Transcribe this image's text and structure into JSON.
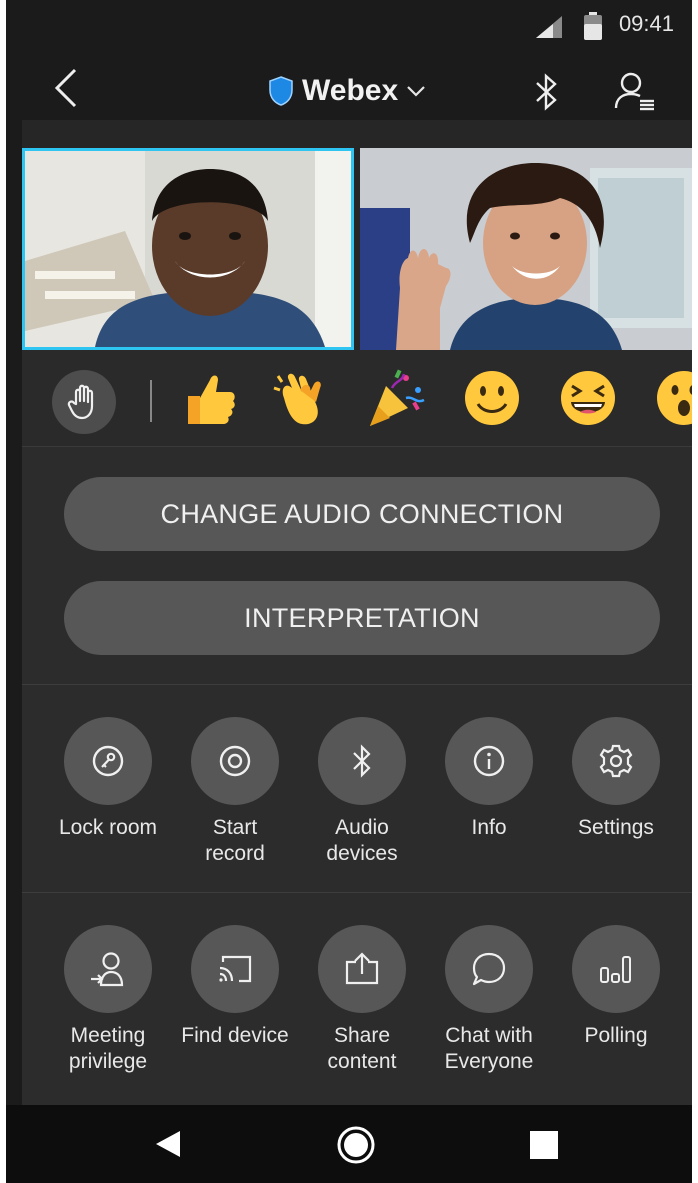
{
  "status": {
    "time": "09:41"
  },
  "header": {
    "title": "Webex",
    "back_icon": "chevron-left-icon",
    "bluetooth_icon": "bluetooth-icon",
    "participants_icon": "participants-icon"
  },
  "reactions": {
    "hand_icon": "raise-hand-icon",
    "items": [
      "thumbs-up",
      "clapping-hands",
      "party-popper",
      "smiley",
      "laughing",
      "surprised"
    ]
  },
  "actions": {
    "change_audio": "CHANGE AUDIO CONNECTION",
    "interpretation": "INTERPRETATION"
  },
  "grid": {
    "row1": [
      {
        "line1": "Lock room",
        "line2": "",
        "icon": "key-icon"
      },
      {
        "line1": "Start",
        "line2": "record",
        "icon": "record-icon"
      },
      {
        "line1": "Audio",
        "line2": "devices",
        "icon": "bluetooth-icon"
      },
      {
        "line1": "Info",
        "line2": "",
        "icon": "info-icon"
      },
      {
        "line1": "Settings",
        "line2": "",
        "icon": "gear-icon"
      }
    ],
    "row2": [
      {
        "line1": "Meeting",
        "line2": "privilege",
        "icon": "meeting-privilege-icon"
      },
      {
        "line1": "Find device",
        "line2": "",
        "icon": "cast-icon"
      },
      {
        "line1": "Share",
        "line2": "content",
        "icon": "share-icon"
      },
      {
        "line1": "Chat with",
        "line2": "Everyone",
        "icon": "chat-icon"
      },
      {
        "line1": "Polling",
        "line2": "",
        "icon": "polling-icon"
      }
    ]
  },
  "colors": {
    "accent": "#2ec5f2",
    "shield": "#1e88e5",
    "button": "#575757",
    "panel": "#2c2c2c"
  }
}
